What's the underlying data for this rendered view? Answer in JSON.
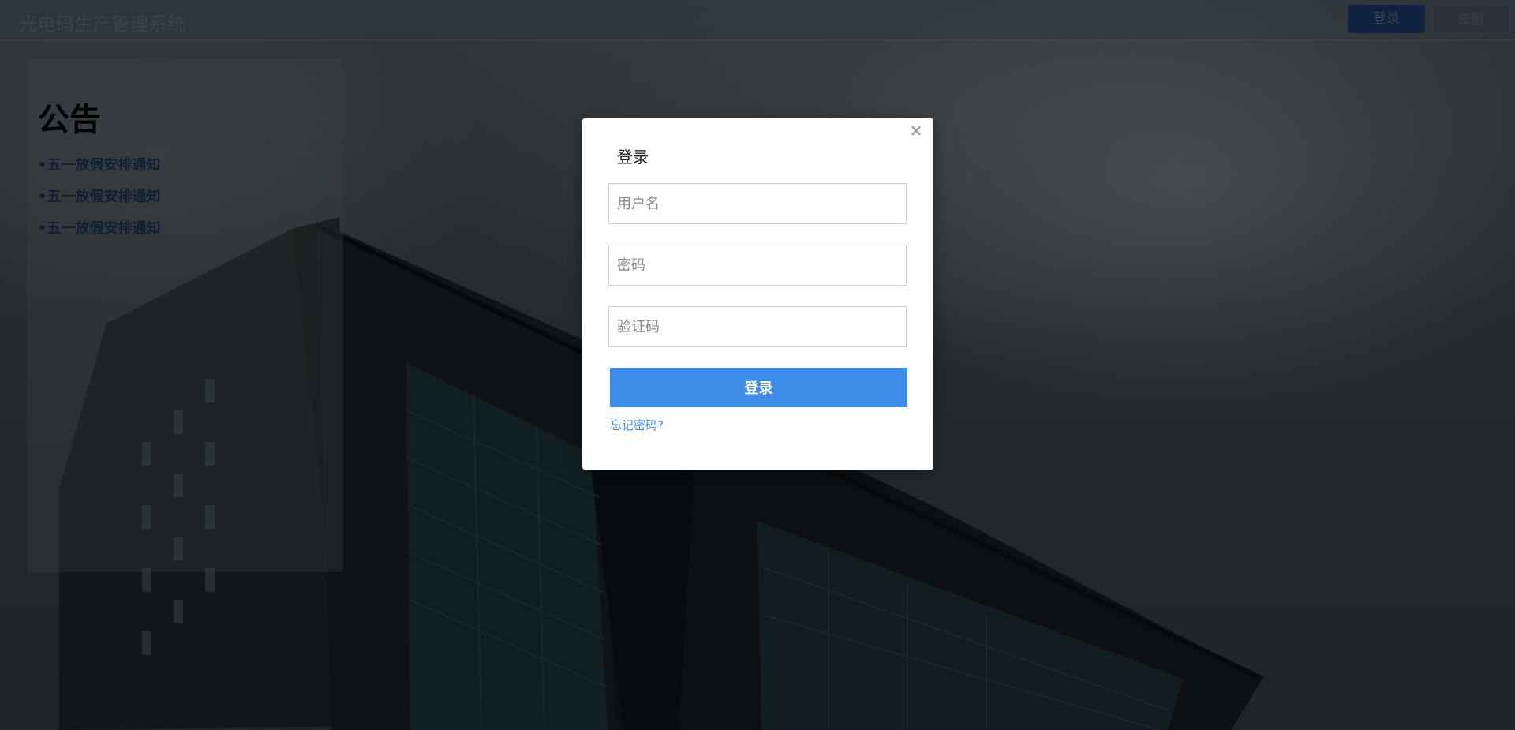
{
  "header": {
    "app_title": "光电码生产管理系统",
    "login_label": "登录",
    "register_label": "注册"
  },
  "notice": {
    "heading": "公告",
    "items": [
      {
        "bullet": "•",
        "text": "五一放假安排通知"
      },
      {
        "bullet": "•",
        "text": "五一放假安排通知"
      },
      {
        "bullet": "•",
        "text": "五一放假安排通知"
      }
    ]
  },
  "login_modal": {
    "title": "登录",
    "close_icon": "×",
    "username_placeholder": "用户名",
    "password_placeholder": "密码",
    "captcha_placeholder": "验证码",
    "submit_label": "登录",
    "forgot_label": "忘记密码?"
  },
  "colors": {
    "primary": "#3d8de8",
    "header_login_bg": "#173766",
    "notice_link": "#1a3350"
  }
}
